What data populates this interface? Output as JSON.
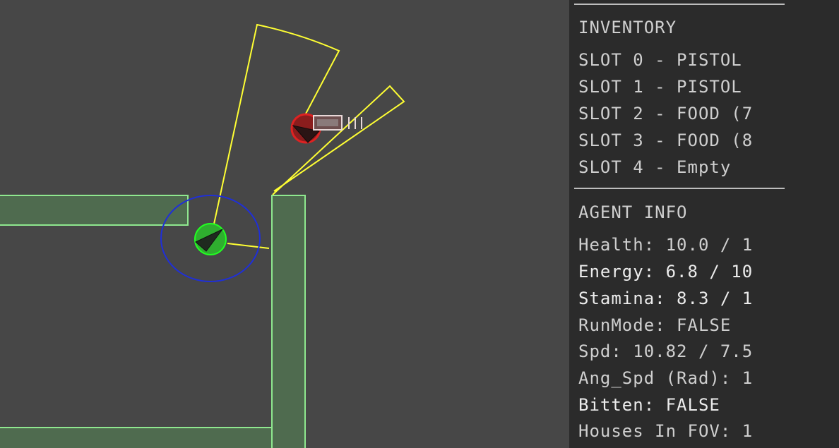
{
  "colors": {
    "background": "#474747",
    "panel": "#2b2b2b",
    "wall_fill": "#4f6b4f",
    "wall_outline": "#8fe88f",
    "fov": "#ffff33",
    "player": "#2fae2f",
    "hearing_ring": "#1f2fd8",
    "zombie": "#cc2222"
  },
  "inventory": {
    "title": "INVENTORY",
    "slots": [
      "SLOT 0 - PISTOL",
      "SLOT 1 - PISTOL",
      "SLOT 2 - FOOD (7",
      "SLOT 3 - FOOD (8",
      "SLOT 4 - Empty"
    ]
  },
  "agent_info": {
    "title": "AGENT INFO",
    "lines": [
      "Health: 10.0 / 1",
      "Energy: 6.8 / 10",
      "Stamina: 8.3 / 1",
      "RunMode: FALSE",
      "Spd: 10.82 / 7.5",
      "Ang_Spd (Rad): 1",
      "Bitten: FALSE",
      "Houses In FOV: 1"
    ]
  },
  "scene": {
    "player_icon": "player-agent-icon",
    "zombie_icon": "zombie-icon",
    "item_icon": "pistol-item-icon"
  }
}
